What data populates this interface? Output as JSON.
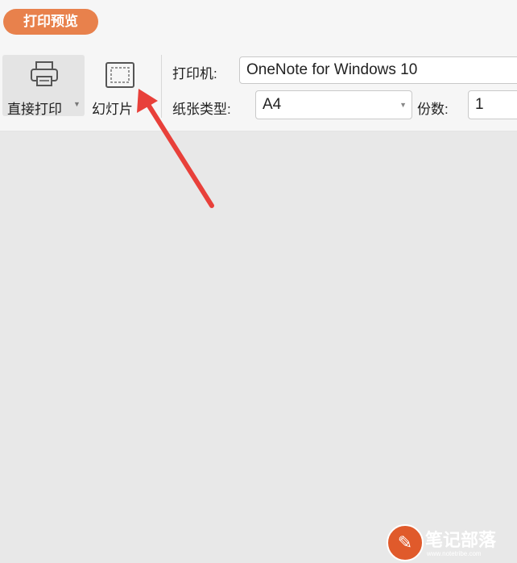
{
  "tab": {
    "label": "打印预览"
  },
  "toolbar": {
    "direct_print_label": "直接打印",
    "slideshow_label": "幻灯片",
    "printer_label": "打印机:",
    "printer_value": "OneNote for Windows 10",
    "paper_type_label": "纸张类型:",
    "paper_type_value": "A4",
    "copies_label": "份数:",
    "copies_value": "1"
  },
  "watermark": {
    "brand": "笔记部落",
    "url": "www.notetribe.com"
  },
  "colors": {
    "accent": "#e8814c",
    "annotation_arrow": "#e8403a",
    "canvas": "#e8e8e8"
  },
  "icons": {
    "printer": "printer-icon",
    "slideshow": "slideshow-icon",
    "dropdown": "chevron-down-icon"
  }
}
